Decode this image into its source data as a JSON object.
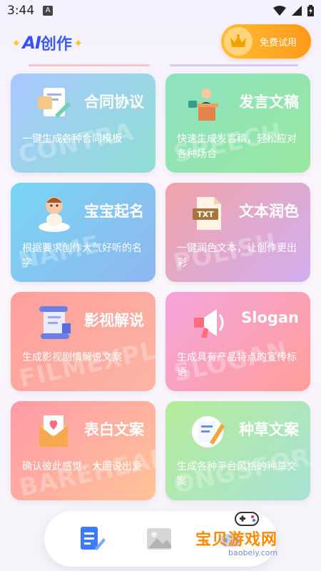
{
  "status": {
    "time": "3:44",
    "notice": "A"
  },
  "header": {
    "logo_ai": "AI",
    "logo_text": "创作",
    "trial_label": "免费试用"
  },
  "cards": [
    {
      "title": "合同协议",
      "desc": "一键生成各种合同模板",
      "watermark": "CONTRA",
      "icon": "document-pen-icon"
    },
    {
      "title": "发言文稿",
      "desc": "快速生成发言稿，轻松应对各种场合",
      "watermark": "SPEECH",
      "icon": "speaker-podium-icon"
    },
    {
      "title": "宝宝起名",
      "desc": "根据要求创作大气好听的名字",
      "watermark": "NAME",
      "icon": "baby-icon"
    },
    {
      "title": "文本润色",
      "desc": "一键润色文本，让创作更出彩",
      "watermark": "POLISH",
      "icon": "txt-file-icon"
    },
    {
      "title": "影视解说",
      "desc": "生成影视剧情解说文案",
      "watermark": "FILMEXPLAI",
      "icon": "scroll-icon"
    },
    {
      "title": "Slogan",
      "desc": "生成具有产品特点的宣传标语",
      "watermark": "SLOGAN",
      "icon": "megaphone-icon"
    },
    {
      "title": "表白文案",
      "desc": "确认彼此感觉，大胆说出爱",
      "watermark": "BAREHEART",
      "icon": "love-letter-icon"
    },
    {
      "title": "种草文案",
      "desc": "生成各种平台风格的种草文案",
      "watermark": "ONGSFOR",
      "icon": "notebook-pencil-icon"
    }
  ],
  "nav": {
    "items": [
      "create-icon",
      "gallery-icon",
      "game-icon"
    ]
  },
  "brand": {
    "name": "宝贝游戏网",
    "url": "baobeiy.com"
  }
}
